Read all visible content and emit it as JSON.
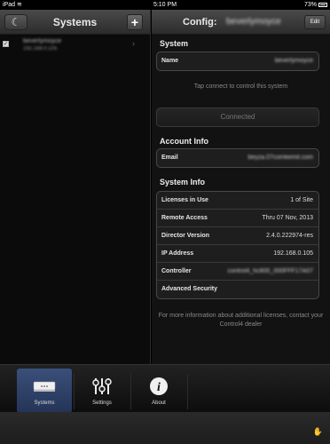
{
  "status_bar": {
    "left": "iPad",
    "time": "5:10 PM",
    "battery": "73%"
  },
  "left_header": {
    "title": "Systems",
    "add_label": "+",
    "logo_glyph": "☾"
  },
  "system_list": [
    {
      "name": "beverlymoyce",
      "ip": "192.168.0.105",
      "checked": true
    }
  ],
  "right_header": {
    "title": "Config:",
    "system_name": "beverlymoyce",
    "edit_label": "Edit"
  },
  "system_section": {
    "heading": "System",
    "name_label": "Name",
    "name_value": "beverlymoyce",
    "hint": "Tap connect to control this system",
    "connected_label": "Connected"
  },
  "account_section": {
    "heading": "Account Info",
    "email_label": "Email",
    "email_value": "beyza.07comkemit.com"
  },
  "info_section": {
    "heading": "System Info",
    "rows": [
      {
        "label": "Licenses in Use",
        "value": "1 of Site"
      },
      {
        "label": "Remote Access",
        "value": "Thru 07 Nov, 2013"
      },
      {
        "label": "Director Version",
        "value": "2.4.0.222974-res"
      },
      {
        "label": "IP Address",
        "value": "192.168.0.105"
      },
      {
        "label": "Controller",
        "value": "control4_hc800_000FFF17A07"
      },
      {
        "label": "Advanced Security",
        "value": ""
      }
    ]
  },
  "footnote": "For more information about additional licenses, contact your Control4 dealer",
  "tabs": [
    {
      "label": "Systems",
      "icon": "device-icon",
      "active": true
    },
    {
      "label": "Settings",
      "icon": "sliders-icon",
      "active": false
    },
    {
      "label": "About",
      "icon": "info-icon",
      "active": false
    }
  ]
}
